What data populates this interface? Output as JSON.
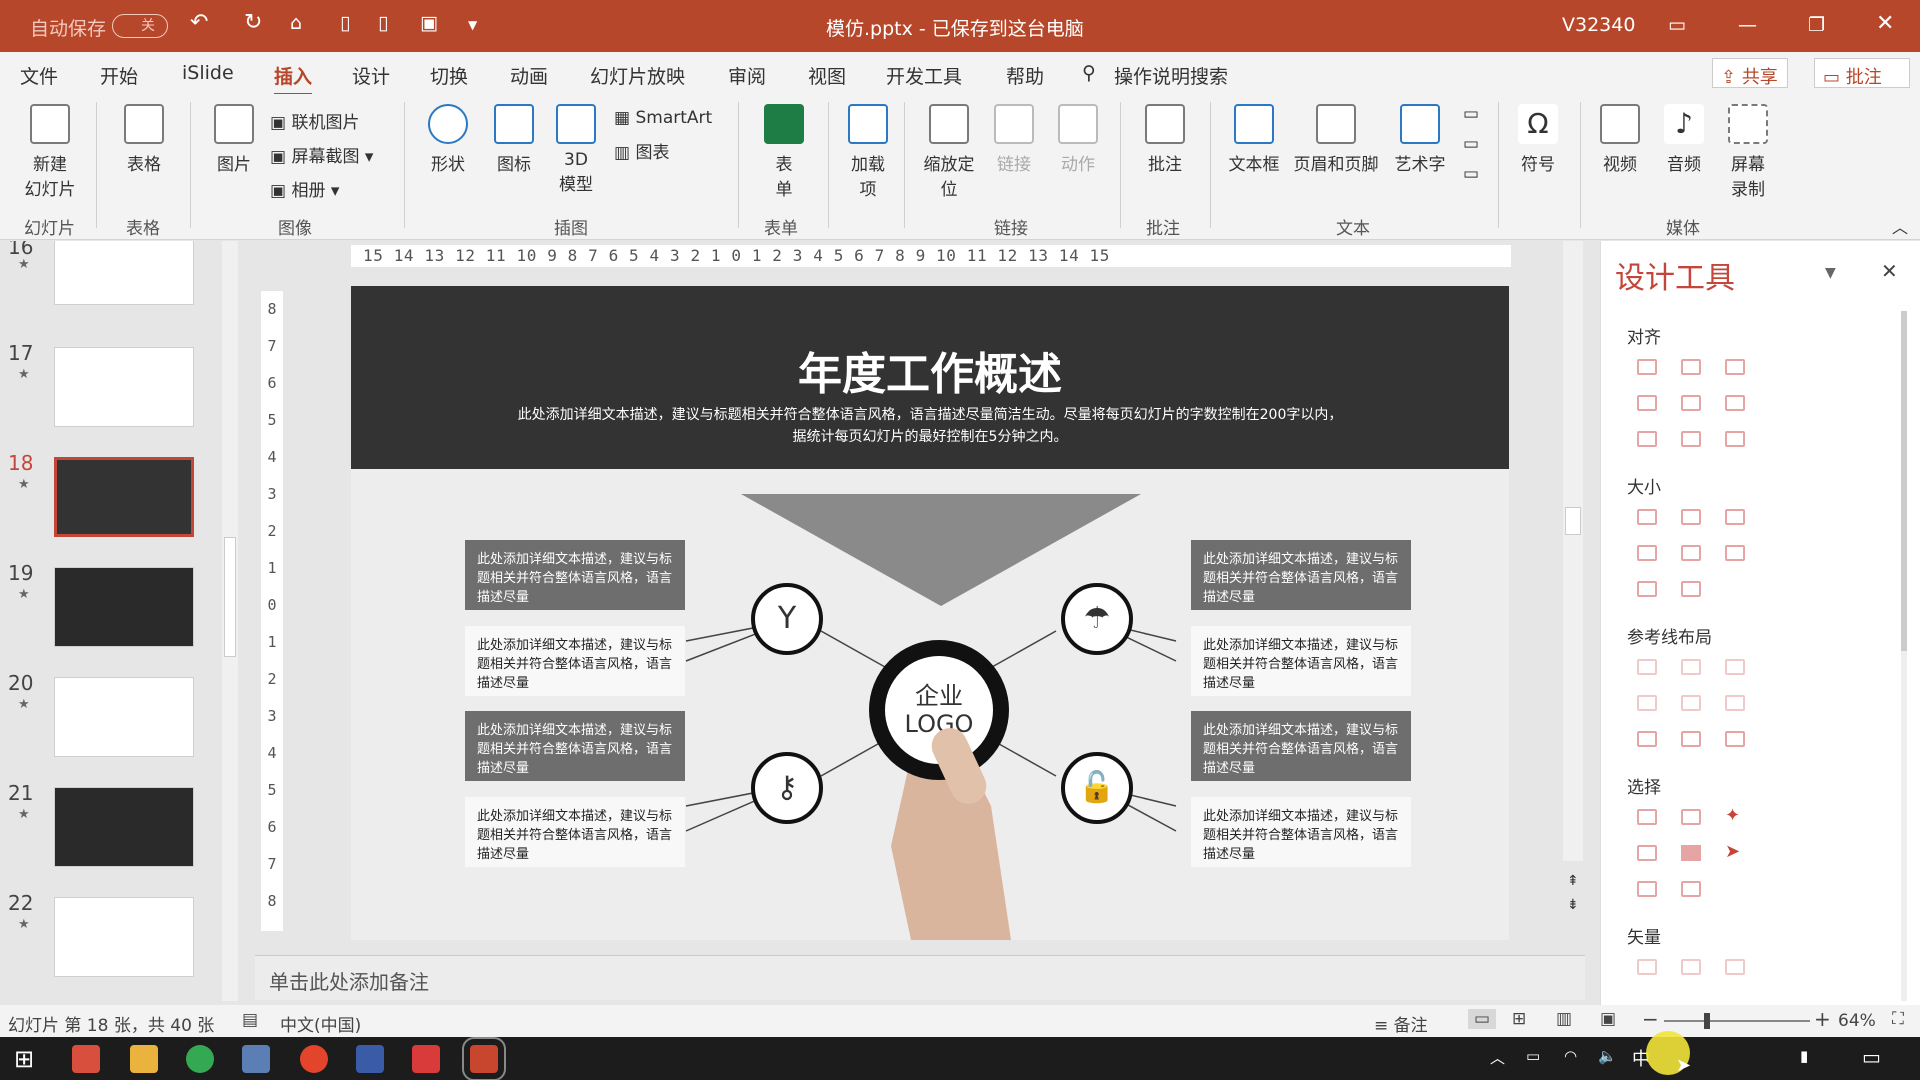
{
  "titlebar": {
    "autosave": "自动保存",
    "autosave_state": "关",
    "doc_title": "模仿.pptx - 已保存到这台电脑",
    "user": "V32340"
  },
  "menu": {
    "items": [
      "文件",
      "开始",
      "iSlide",
      "插入",
      "设计",
      "切换",
      "动画",
      "幻灯片放映",
      "审阅",
      "视图",
      "开发工具",
      "帮助"
    ],
    "active": "插入",
    "search": "操作说明搜索",
    "share": "共享",
    "comment": "批注"
  },
  "ribbon": {
    "new_slide": "新建\n幻灯片",
    "table": "表格",
    "picture": "图片",
    "online_pic": "联机图片",
    "screenshot": "屏幕截图",
    "album": "相册",
    "shapes": "形状",
    "icons": "图标",
    "model3d": "3D\n模型",
    "smartart": "SmartArt",
    "chart": "图表",
    "form": "表\n单",
    "addins": "加载\n项",
    "zoom": "缩放定\n位",
    "link": "链接",
    "action": "动作",
    "comment": "批注",
    "textbox": "文本框",
    "header_footer": "页眉和页脚",
    "wordart": "艺术字",
    "symbol": "符号",
    "video": "视频",
    "audio": "音频",
    "screen_rec": "屏幕\n录制",
    "groups": [
      "幻灯片",
      "表格",
      "图像",
      "插图",
      "表单",
      "链接",
      "批注",
      "文本",
      "媒体"
    ]
  },
  "ruler_h": "15 14 13 12 11 10  9  8  7  6  5  4  3  2  1  0  1  2  3  4  5  6  7  8  9 10 11 12 13 14 15",
  "ruler_v": [
    "8",
    "7",
    "6",
    "5",
    "4",
    "3",
    "2",
    "1",
    "0",
    "1",
    "2",
    "3",
    "4",
    "5",
    "6",
    "7",
    "8"
  ],
  "thumbs": [
    {
      "n": "16"
    },
    {
      "n": "17"
    },
    {
      "n": "18"
    },
    {
      "n": "19"
    },
    {
      "n": "20"
    },
    {
      "n": "21"
    },
    {
      "n": "22"
    }
  ],
  "slide": {
    "title": "年度工作概述",
    "desc1": "此处添加详细文本描述，建议与标题相关并符合整体语言风格，语言描述尽量简洁生动。尽量将每页幻灯片的字数控制在200字以内，",
    "desc2": "据统计每页幻灯片的最好控制在5分钟之内。",
    "box_text": "此处添加详细文本描述，建议与标题相关并符合整体语言风格，语言描述尽量",
    "logo_1": "企业",
    "logo_2": "LOGO"
  },
  "notes": {
    "placeholder": "单击此处添加备注"
  },
  "pane": {
    "title": "设计工具",
    "sections": [
      "对齐",
      "大小",
      "参考线布局",
      "选择",
      "矢量"
    ]
  },
  "status": {
    "slide_info": "幻灯片 第 18 张，共 40 张",
    "lang": "中文(中国)",
    "notes": "备注",
    "zoom": "64%"
  },
  "taskbar": {
    "ime": "中"
  },
  "colors": {
    "accent": "#b7472a",
    "pane_title": "#c4463a"
  }
}
